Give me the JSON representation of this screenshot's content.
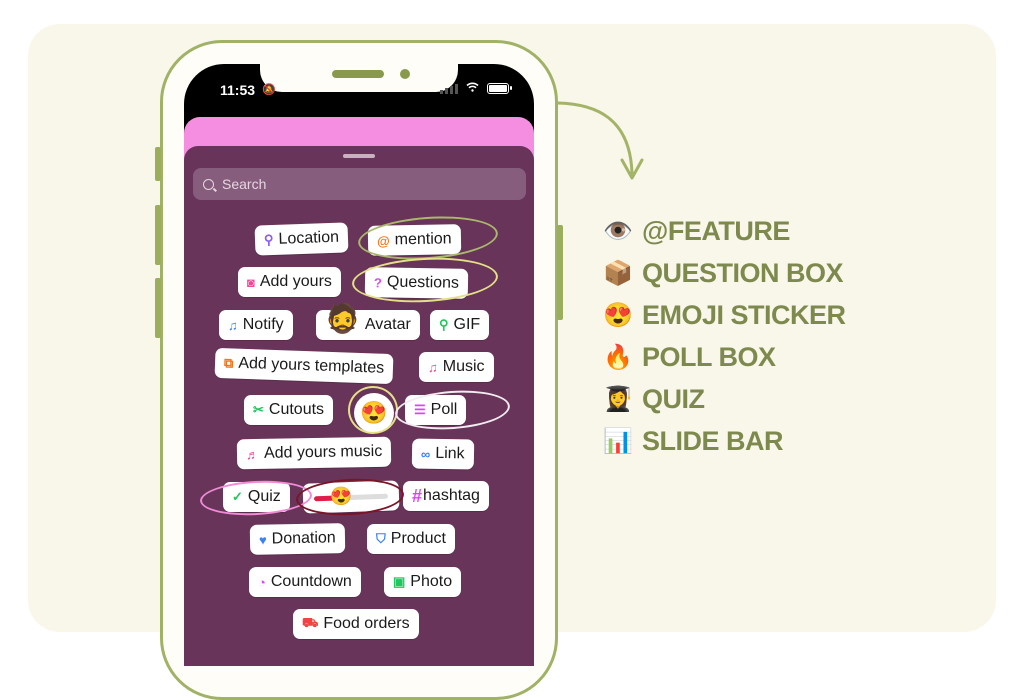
{
  "status_bar": {
    "time": "11:53",
    "bell_icon": "bell-slash-icon"
  },
  "search": {
    "placeholder": "Search"
  },
  "stickers": [
    {
      "label": "Location",
      "icon": "pin-icon",
      "glyph": "⚲",
      "color": "#8b5cf6"
    },
    {
      "label": "mention",
      "icon": "threads-at-icon",
      "glyph": "@",
      "color": "#f97316"
    },
    {
      "label": "Add yours",
      "icon": "camera-icon",
      "glyph": "◙",
      "color": "#ec4899"
    },
    {
      "label": "Questions",
      "icon": "question-bubble-icon",
      "glyph": "?",
      "color": "#d946ef"
    },
    {
      "label": "Notify",
      "icon": "bell-icon",
      "glyph": "♫",
      "color": "#3b82f6"
    },
    {
      "label": "Avatar",
      "icon": "avatar-image",
      "glyph": "🧔",
      "color": "#000000"
    },
    {
      "label": "GIF",
      "icon": "search-icon",
      "glyph": "⚲",
      "color": "#22c55e"
    },
    {
      "label": "Add yours templates",
      "icon": "template-plus-icon",
      "glyph": "⧉",
      "color": "#f97316"
    },
    {
      "label": "Music",
      "icon": "music-icon",
      "glyph": "♫",
      "color": "#ec4899"
    },
    {
      "label": "Cutouts",
      "icon": "scissors-icon",
      "glyph": "✂",
      "color": "#22c55e"
    },
    {
      "label": "",
      "icon": "heart-eyes-emoji",
      "glyph": "😍",
      "color": "#000000"
    },
    {
      "label": "Poll",
      "icon": "poll-lines-icon",
      "glyph": "☰",
      "color": "#d946ef"
    },
    {
      "label": "Add yours music",
      "icon": "music-plus-icon",
      "glyph": "♬",
      "color": "#ec4899"
    },
    {
      "label": "Link",
      "icon": "link-icon",
      "glyph": "∞",
      "color": "#3b82f6"
    },
    {
      "label": "Quiz",
      "icon": "check-circle-icon",
      "glyph": "✓",
      "color": "#22c55e"
    },
    {
      "label": "",
      "icon": "emoji-slider",
      "glyph": "😍",
      "color": "#e11d48"
    },
    {
      "label": "hashtag",
      "icon": "hash-icon",
      "glyph": "#",
      "color": "#d946ef"
    },
    {
      "label": "Donation",
      "icon": "donation-heart-icon",
      "glyph": "♥",
      "color": "#3b82f6"
    },
    {
      "label": "Product",
      "icon": "shopping-bag-icon",
      "glyph": "⛉",
      "color": "#3b82f6"
    },
    {
      "label": "Countdown",
      "icon": "timer-icon",
      "glyph": "◔",
      "color": "#d946ef"
    },
    {
      "label": "Photo",
      "icon": "photo-icon",
      "glyph": "▣",
      "color": "#22c55e"
    },
    {
      "label": "Food orders",
      "icon": "delivery-truck-icon",
      "glyph": "⛟",
      "color": "#ef4444"
    }
  ],
  "slider": {
    "value": 0.3
  },
  "legend": [
    {
      "emoji": "👁️",
      "icon": "eye-emoji",
      "label": "@FEATURE"
    },
    {
      "emoji": "📦",
      "icon": "package-emoji",
      "label": "QUESTION BOX"
    },
    {
      "emoji": "😍",
      "icon": "heart-eyes-emoji",
      "label": "EMOJI STICKER"
    },
    {
      "emoji": "🔥",
      "icon": "fire-emoji",
      "label": "POLL BOX"
    },
    {
      "emoji": "👩‍🎓",
      "icon": "student-emoji",
      "label": "QUIZ"
    },
    {
      "emoji": "📊",
      "icon": "bar-chart-emoji",
      "label": "SLIDE BAR"
    }
  ],
  "colors": {
    "accent_green": "#7e8a4d",
    "sheet": "#683459",
    "pink": "#f58de0",
    "card_bg": "#f9f6ea"
  }
}
